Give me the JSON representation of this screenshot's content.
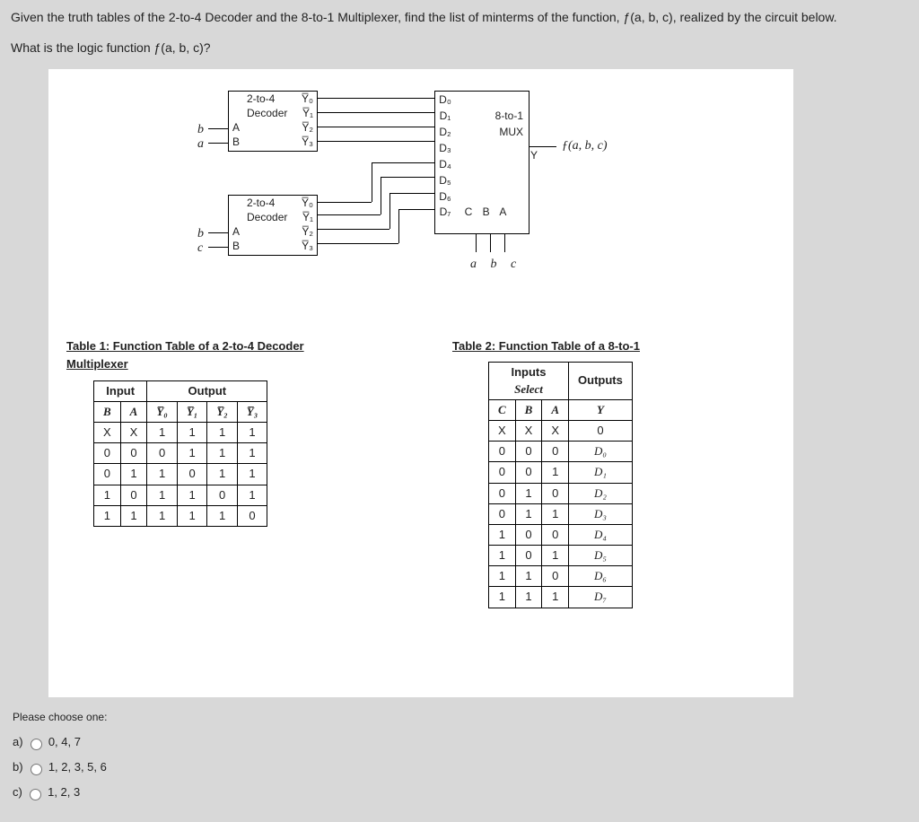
{
  "intro": "Given the truth tables of the 2-to-4 Decoder and the 8-to-1 Multiplexer, find the list of minterms of the function, ƒ(a, b, c), realized by the circuit below.",
  "sub": "What is the logic function ƒ(a, b, c)?",
  "circuit": {
    "decoder1": {
      "title": "2-to-4",
      "subtitle": "Decoder",
      "inA_label": "A",
      "inB_label": "B",
      "in_sig_top": "b",
      "in_sig_bot": "a",
      "out0": "Y̅₀",
      "out1": "Y̅₁",
      "out2": "Y̅₂",
      "out3": "Y̅₃"
    },
    "decoder2": {
      "title": "2-to-4",
      "subtitle": "Decoder",
      "inA_label": "A",
      "inB_label": "B",
      "in_sig_top": "b",
      "in_sig_bot": "c",
      "out0": "Y̅₀",
      "out1": "Y̅₁",
      "out2": "Y̅₂",
      "out3": "Y̅₃"
    },
    "mux": {
      "title1": "8-to-1",
      "title2": "MUX",
      "d": [
        "D₀",
        "D₁",
        "D₂",
        "D₃",
        "D₄",
        "D₅",
        "D₆",
        "D₇"
      ],
      "out_label": "Y",
      "sel_top": "C  B  A",
      "sel_bot": "a  b  c"
    },
    "output_func": "ƒ(a, b, c)"
  },
  "table1": {
    "title": "Table 1: Function Table of a 2-to-4 Decoder",
    "title_extra": "Multiplexer",
    "hdr_input": "Input",
    "hdr_output": "Output",
    "cols": [
      "B",
      "A",
      "Y̅₀",
      "Y̅₁",
      "Y̅₂",
      "Y̅₃"
    ],
    "rows": [
      [
        "X",
        "X",
        "1",
        "1",
        "1",
        "1"
      ],
      [
        "0",
        "0",
        "0",
        "1",
        "1",
        "1"
      ],
      [
        "0",
        "1",
        "1",
        "0",
        "1",
        "1"
      ],
      [
        "1",
        "0",
        "1",
        "1",
        "0",
        "1"
      ],
      [
        "1",
        "1",
        "1",
        "1",
        "1",
        "0"
      ]
    ]
  },
  "table2": {
    "title": "Table 2: Function Table of a 8-to-1",
    "hdr_inputs_top": "Inputs",
    "hdr_inputs_sub": "Select",
    "hdr_outputs": "Outputs",
    "cols": [
      "C",
      "B",
      "A",
      "Y"
    ],
    "rows": [
      [
        "X",
        "X",
        "X",
        "0"
      ],
      [
        "0",
        "0",
        "0",
        "D₀"
      ],
      [
        "0",
        "0",
        "1",
        "D₁"
      ],
      [
        "0",
        "1",
        "0",
        "D₂"
      ],
      [
        "0",
        "1",
        "1",
        "D₃"
      ],
      [
        "1",
        "0",
        "0",
        "D₄"
      ],
      [
        "1",
        "0",
        "1",
        "D₅"
      ],
      [
        "1",
        "1",
        "0",
        "D₆"
      ],
      [
        "1",
        "1",
        "1",
        "D₇"
      ]
    ]
  },
  "options": {
    "prompt": "Please choose one:",
    "a_prefix": "a)",
    "a_text": "0, 4, 7",
    "b_prefix": "b)",
    "b_text": "1, 2, 3, 5, 6",
    "c_prefix": "c)",
    "c_text": "1, 2, 3"
  }
}
